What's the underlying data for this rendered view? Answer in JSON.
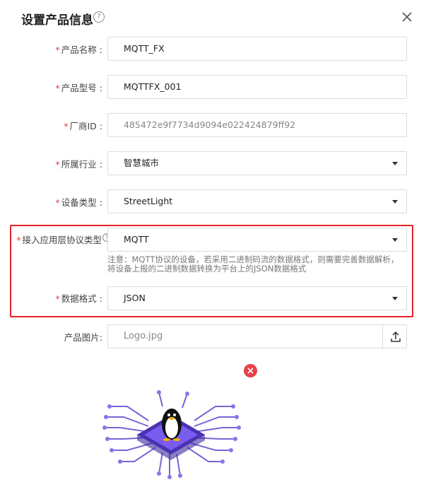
{
  "dialog": {
    "title": "设置产品信息",
    "help_icon": "?",
    "close_icon": "close-icon"
  },
  "form": {
    "product_name": {
      "label": "产品名称",
      "value": "MQTT_FX"
    },
    "product_model": {
      "label": "产品型号",
      "value": "MQTTFX_001"
    },
    "vendor_id": {
      "label": "厂商ID",
      "value": "485472e9f7734d9094e022424879ff92"
    },
    "industry": {
      "label": "所属行业",
      "value": "智慧城市"
    },
    "device_type": {
      "label": "设备类型",
      "value": "StreetLight"
    },
    "protocol": {
      "label": "接入应用层协议类型",
      "value": "MQTT",
      "note": "注意：MQTT协议的设备，若采用二进制码流的数据格式，则需要完善数据解析，将设备上报的二进制数据转换为平台上的JSON数据格式"
    },
    "data_format": {
      "label": "数据格式",
      "value": "JSON"
    },
    "product_image": {
      "label": "产品图片:",
      "placeholder": "Logo.jpg"
    }
  },
  "colors": {
    "required": "#e04040",
    "highlight": "#e4232b",
    "remove": "#e8414a",
    "chip": "#6b4de6"
  }
}
